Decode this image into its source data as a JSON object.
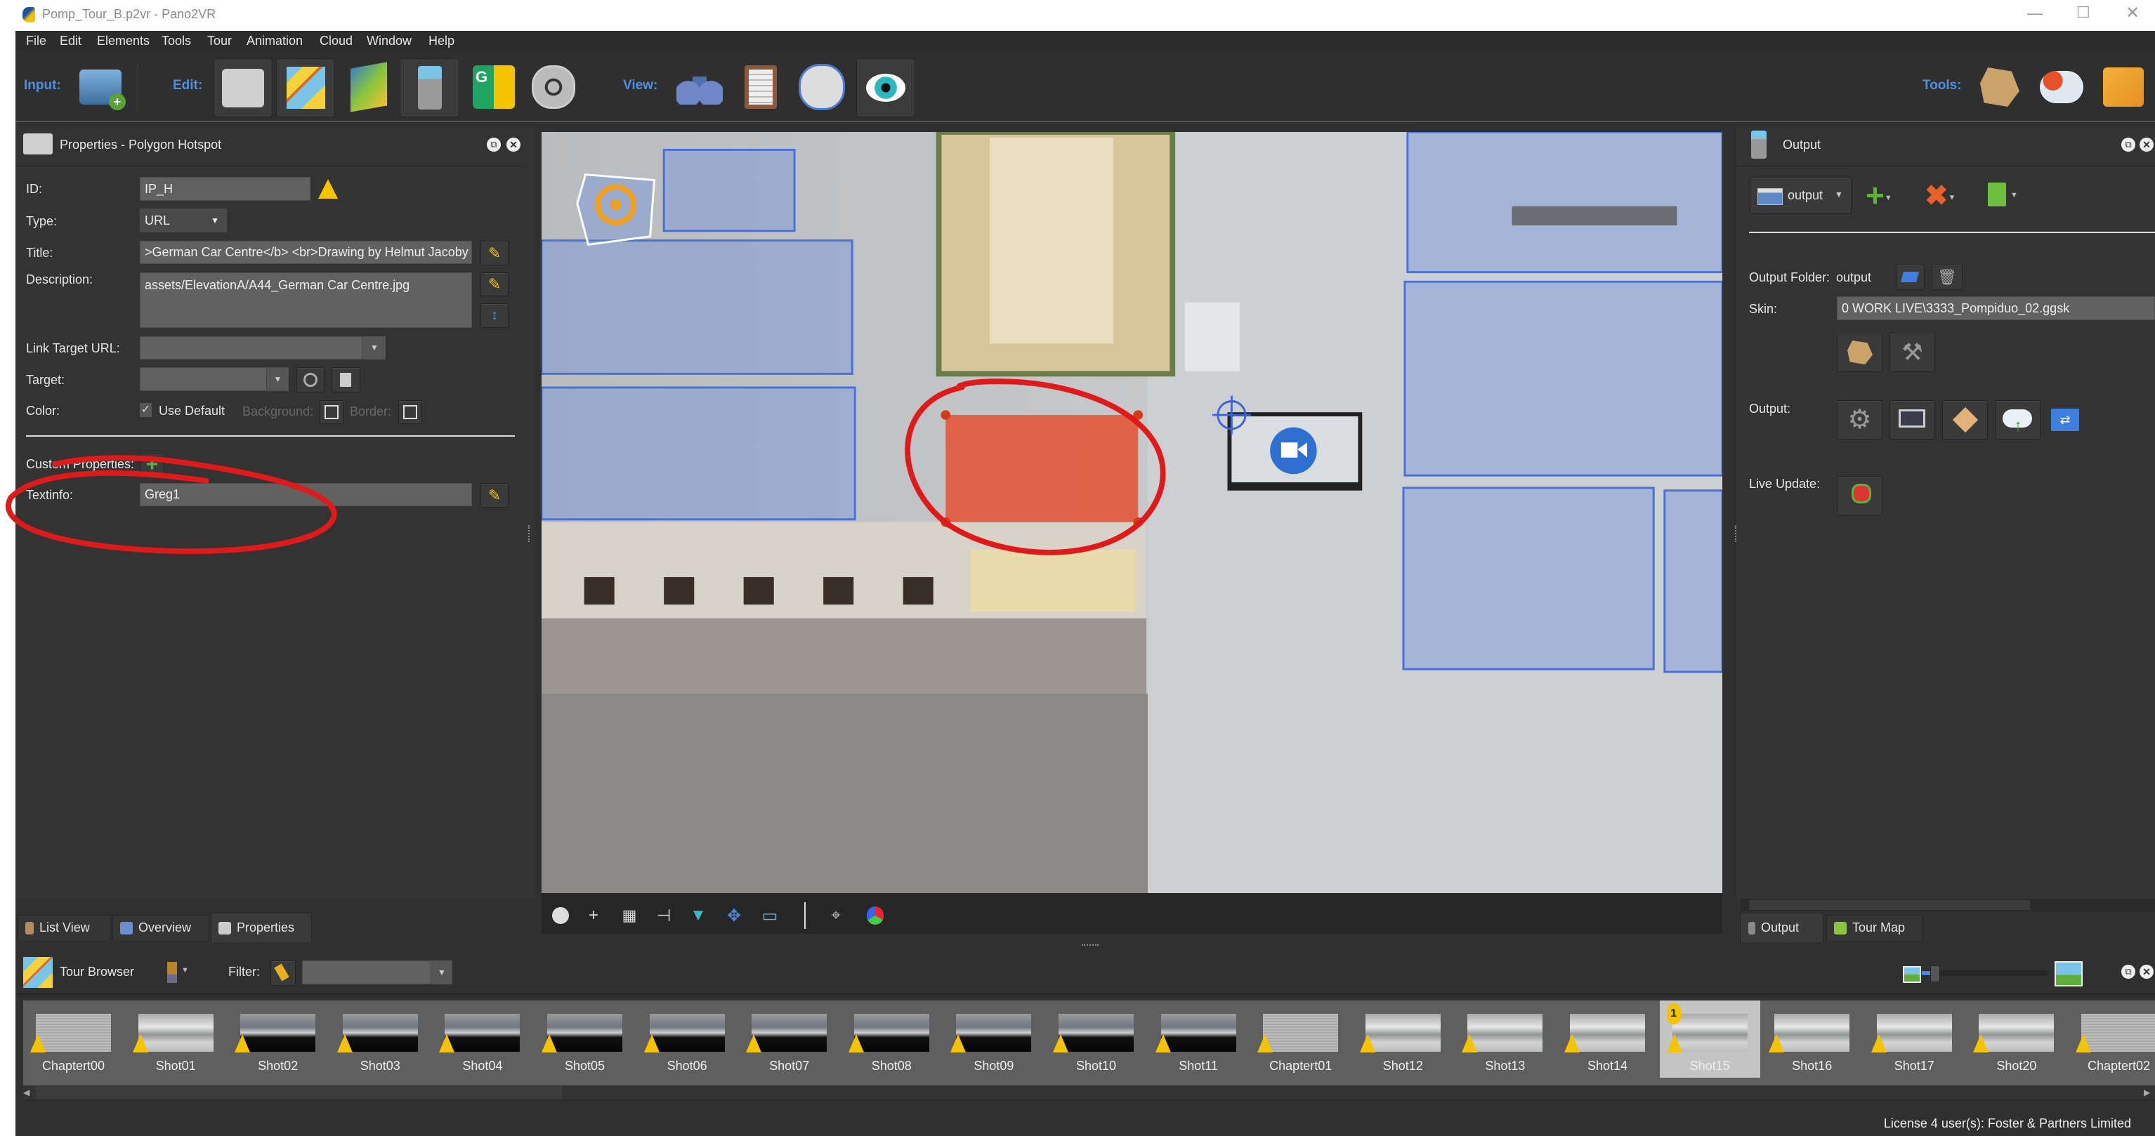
{
  "window": {
    "title": "Pomp_Tour_B.p2vr - Pano2VR"
  },
  "menu": [
    "File",
    "Edit",
    "Elements",
    "Tools",
    "Tour",
    "Animation",
    "Cloud",
    "Window",
    "Help"
  ],
  "toolbar": {
    "input_label": "Input:",
    "edit_label": "Edit:",
    "view_label": "View:",
    "tools_label": "Tools:",
    "accent_color": "#4f8fe0"
  },
  "properties": {
    "header": "Properties - Polygon Hotspot",
    "id_label": "ID:",
    "id_value": "IP_H",
    "type_label": "Type:",
    "type_value": "URL",
    "title_label": "Title:",
    "title_value": ">German Car Centre</b> <br>Drawing by Helmut Jacoby",
    "description_label": "Description:",
    "description_value": "assets/ElevationA/A44_German Car Centre.jpg",
    "link_label": "Link Target URL:",
    "link_value": "",
    "target_label": "Target:",
    "target_value": "",
    "color_label": "Color:",
    "use_default_label": "Use Default",
    "use_default_checked": true,
    "background_label": "Background:",
    "border_label": "Border:",
    "custom_label": "Custom Properties:",
    "textinfo_label": "Textinfo:",
    "textinfo_value": "Greg1"
  },
  "output": {
    "header": "Output",
    "selector_value": "output",
    "folder_label": "Output Folder:",
    "folder_value": "output",
    "skin_label": "Skin:",
    "skin_value": "0 WORK LIVE\\3333_Pompiduo_02.ggsk",
    "output_label": "Output:",
    "live_update_label": "Live Update:"
  },
  "left_tabs": [
    "List View",
    "Overview",
    "Properties"
  ],
  "right_tabs": [
    "Output",
    "Tour Map"
  ],
  "tour_browser": {
    "title": "Tour Browser",
    "filter_label": "Filter:",
    "filter_value": "",
    "items": [
      {
        "name": "Chaptert00"
      },
      {
        "name": "Shot01"
      },
      {
        "name": "Shot02"
      },
      {
        "name": "Shot03"
      },
      {
        "name": "Shot04"
      },
      {
        "name": "Shot05"
      },
      {
        "name": "Shot06"
      },
      {
        "name": "Shot07"
      },
      {
        "name": "Shot08"
      },
      {
        "name": "Shot09"
      },
      {
        "name": "Shot10"
      },
      {
        "name": "Shot11"
      },
      {
        "name": "Chaptert01"
      },
      {
        "name": "Shot12"
      },
      {
        "name": "Shot13"
      },
      {
        "name": "Shot14"
      },
      {
        "name": "Shot15",
        "selected": true,
        "badge": "1"
      },
      {
        "name": "Shot16"
      },
      {
        "name": "Shot17"
      },
      {
        "name": "Shot20"
      },
      {
        "name": "Chaptert02"
      }
    ]
  },
  "status": {
    "license": "License 4 user(s): Foster & Partners Limited"
  },
  "annotation_color": "#e0191b"
}
